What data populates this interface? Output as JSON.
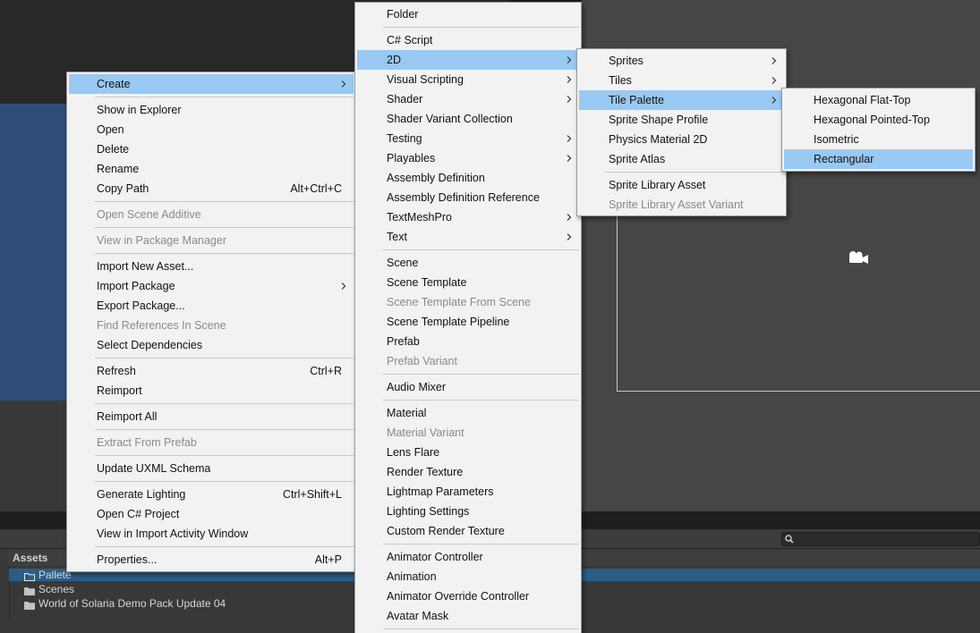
{
  "context_menu": {
    "items": [
      {
        "label": "Create",
        "submenu": true,
        "highlighted": true
      },
      {
        "separator": true
      },
      {
        "label": "Show in Explorer"
      },
      {
        "label": "Open"
      },
      {
        "label": "Delete"
      },
      {
        "label": "Rename"
      },
      {
        "label": "Copy Path",
        "shortcut": "Alt+Ctrl+C"
      },
      {
        "separator": true
      },
      {
        "label": "Open Scene Additive",
        "disabled": true
      },
      {
        "separator": true
      },
      {
        "label": "View in Package Manager",
        "disabled": true
      },
      {
        "separator": true
      },
      {
        "label": "Import New Asset..."
      },
      {
        "label": "Import Package",
        "submenu": true
      },
      {
        "label": "Export Package..."
      },
      {
        "label": "Find References In Scene",
        "disabled": true
      },
      {
        "label": "Select Dependencies"
      },
      {
        "separator": true
      },
      {
        "label": "Refresh",
        "shortcut": "Ctrl+R"
      },
      {
        "label": "Reimport"
      },
      {
        "separator": true
      },
      {
        "label": "Reimport All"
      },
      {
        "separator": true
      },
      {
        "label": "Extract From Prefab",
        "disabled": true
      },
      {
        "separator": true
      },
      {
        "label": "Update UXML Schema"
      },
      {
        "separator": true
      },
      {
        "label": "Generate Lighting",
        "shortcut": "Ctrl+Shift+L"
      },
      {
        "label": "Open C# Project"
      },
      {
        "label": "View in Import Activity Window"
      },
      {
        "separator": true
      },
      {
        "label": "Properties...",
        "shortcut": "Alt+P"
      }
    ]
  },
  "create_menu": {
    "items": [
      {
        "label": "Folder"
      },
      {
        "separator": true
      },
      {
        "label": "C# Script"
      },
      {
        "label": "2D",
        "submenu": true,
        "highlighted": true
      },
      {
        "label": "Visual Scripting",
        "submenu": true
      },
      {
        "label": "Shader",
        "submenu": true
      },
      {
        "label": "Shader Variant Collection"
      },
      {
        "label": "Testing",
        "submenu": true
      },
      {
        "label": "Playables",
        "submenu": true
      },
      {
        "label": "Assembly Definition"
      },
      {
        "label": "Assembly Definition Reference"
      },
      {
        "label": "TextMeshPro",
        "submenu": true
      },
      {
        "label": "Text",
        "submenu": true
      },
      {
        "separator": true
      },
      {
        "label": "Scene"
      },
      {
        "label": "Scene Template"
      },
      {
        "label": "Scene Template From Scene",
        "disabled": true
      },
      {
        "label": "Scene Template Pipeline"
      },
      {
        "label": "Prefab"
      },
      {
        "label": "Prefab Variant",
        "disabled": true
      },
      {
        "separator": true
      },
      {
        "label": "Audio Mixer"
      },
      {
        "separator": true
      },
      {
        "label": "Material"
      },
      {
        "label": "Material Variant",
        "disabled": true
      },
      {
        "label": "Lens Flare"
      },
      {
        "label": "Render Texture"
      },
      {
        "label": "Lightmap Parameters"
      },
      {
        "label": "Lighting Settings"
      },
      {
        "label": "Custom Render Texture"
      },
      {
        "separator": true
      },
      {
        "label": "Animator Controller"
      },
      {
        "label": "Animation"
      },
      {
        "label": "Animator Override Controller"
      },
      {
        "label": "Avatar Mask"
      },
      {
        "separator": true
      }
    ]
  },
  "menu_2d": {
    "items": [
      {
        "label": "Sprites",
        "submenu": true
      },
      {
        "label": "Tiles",
        "submenu": true
      },
      {
        "label": "Tile Palette",
        "submenu": true,
        "highlighted": true
      },
      {
        "label": "Sprite Shape Profile"
      },
      {
        "label": "Physics Material 2D"
      },
      {
        "label": "Sprite Atlas"
      },
      {
        "separator": true
      },
      {
        "label": "Sprite Library Asset"
      },
      {
        "label": "Sprite Library Asset Variant",
        "disabled": true
      }
    ]
  },
  "menu_tile_palette": {
    "items": [
      {
        "label": "Hexagonal Flat-Top"
      },
      {
        "label": "Hexagonal Pointed-Top"
      },
      {
        "label": "Isometric"
      },
      {
        "label": "Rectangular",
        "highlighted": true
      }
    ]
  },
  "project": {
    "header": "Assets",
    "folders": [
      {
        "label": "Pallete",
        "selected": true
      },
      {
        "label": "Scenes"
      },
      {
        "label": "World of Solaria Demo Pack Update 04"
      }
    ]
  },
  "colors": {
    "highlight": "#99c9f3",
    "menu_bg": "#f2f2f2",
    "selection_row": "#2c5d87"
  },
  "icons": {
    "submenu": "chevron-right-icon",
    "folder": "folder-icon",
    "search": "search-icon",
    "scene_camera": "camera-icon"
  }
}
